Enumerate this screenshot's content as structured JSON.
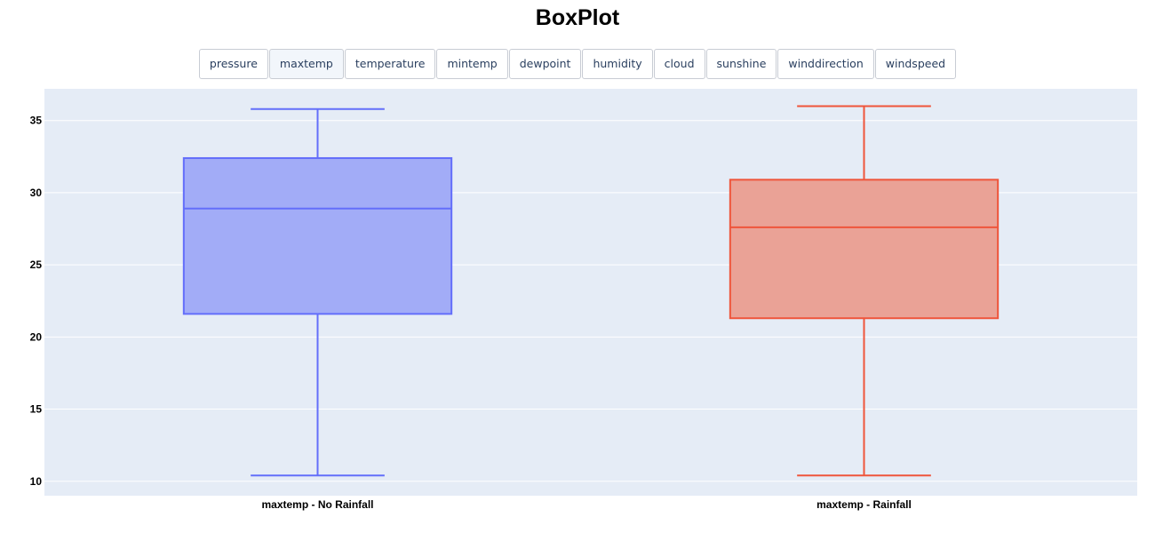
{
  "buttons": [
    {
      "label": "pressure",
      "active": false
    },
    {
      "label": "maxtemp",
      "active": true
    },
    {
      "label": "temperature",
      "active": false
    },
    {
      "label": "mintemp",
      "active": false
    },
    {
      "label": "dewpoint",
      "active": false
    },
    {
      "label": "humidity",
      "active": false
    },
    {
      "label": "cloud",
      "active": false
    },
    {
      "label": "sunshine",
      "active": false
    },
    {
      "label": "winddirection",
      "active": false
    },
    {
      "label": "windspeed",
      "active": false
    }
  ],
  "chart_data": {
    "type": "box",
    "title": "BoxPlot",
    "xlabel": "",
    "ylabel": "",
    "ylim": [
      9,
      37.2
    ],
    "yticks": [
      10,
      15,
      20,
      25,
      30,
      35
    ],
    "grid": true,
    "plot_background": "#e5ecf6",
    "categories": [
      "maxtemp - No Rainfall",
      "maxtemp - Rainfall"
    ],
    "series": [
      {
        "category": "maxtemp - No Rainfall",
        "min": 10.4,
        "q1": 21.6,
        "median": 28.9,
        "q3": 32.4,
        "max": 35.8,
        "line_color": "#636efa",
        "fill_color": "#a2acf7"
      },
      {
        "category": "maxtemp - Rainfall",
        "min": 10.4,
        "q1": 21.3,
        "median": 27.6,
        "q3": 30.9,
        "max": 36.0,
        "line_color": "#ef553b",
        "fill_color": "#eaa296"
      }
    ]
  }
}
